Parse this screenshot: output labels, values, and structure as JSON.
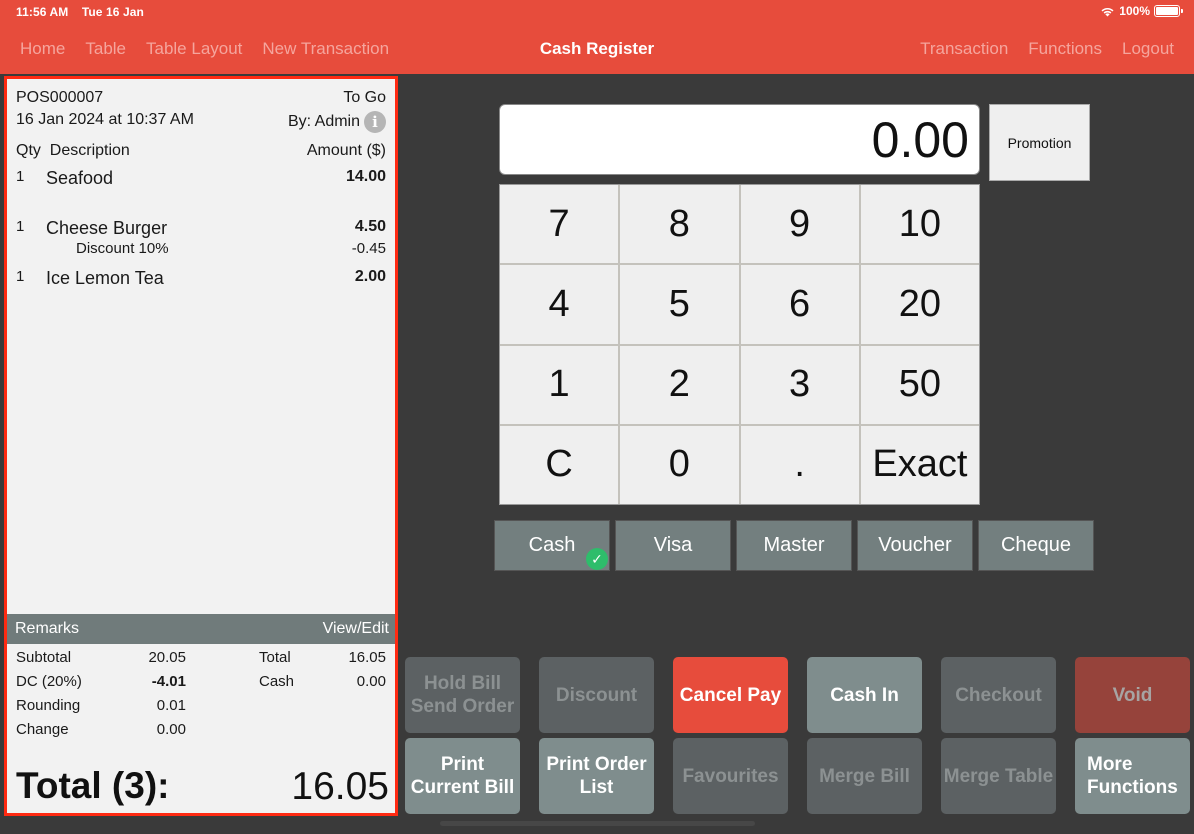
{
  "status_bar": {
    "time": "11:56 AM",
    "date": "Tue 16 Jan",
    "battery": "100%",
    "battery_level": 1.0
  },
  "nav": {
    "left": [
      "Home",
      "Table",
      "Table Layout",
      "New Transaction"
    ],
    "title": "Cash Register",
    "right": [
      "Transaction",
      "Functions",
      "Logout"
    ]
  },
  "receipt": {
    "order_no": "POS000007",
    "order_type": "To Go",
    "datetime": "16 Jan 2024 at 10:37 AM",
    "by": "By: Admin",
    "headers": {
      "qty": "Qty",
      "description": "Description",
      "amount": "Amount ($)"
    },
    "items": [
      {
        "qty": "1",
        "description": "Seafood",
        "amount": "14.00"
      },
      {
        "qty": "1",
        "description": "Cheese Burger",
        "amount": "4.50",
        "sub_description": "Discount 10%",
        "sub_amount": "-0.45"
      },
      {
        "qty": "1",
        "description": "Ice Lemon Tea",
        "amount": "2.00"
      }
    ],
    "remarks_label": "Remarks",
    "remarks_action": "View/Edit",
    "totals_left": [
      {
        "label": "Subtotal",
        "value": "20.05"
      },
      {
        "label": "DC (20%)",
        "value": "-4.01"
      },
      {
        "label": "Rounding",
        "value": "0.01"
      },
      {
        "label": "Change",
        "value": "0.00"
      }
    ],
    "totals_right": [
      {
        "label": "Total",
        "value": "16.05"
      },
      {
        "label": "Cash",
        "value": "0.00"
      }
    ],
    "grand_label": "Total (3):",
    "grand_value": "16.05"
  },
  "display": {
    "value": "0.00"
  },
  "promotion_label": "Promotion",
  "keypad": [
    "7",
    "8",
    "9",
    "10",
    "4",
    "5",
    "6",
    "20",
    "1",
    "2",
    "3",
    "50",
    "C",
    "0",
    ".",
    "Exact"
  ],
  "payment_methods": [
    {
      "label": "Cash",
      "selected": true
    },
    {
      "label": "Visa",
      "selected": false
    },
    {
      "label": "Master",
      "selected": false
    },
    {
      "label": "Voucher",
      "selected": false
    },
    {
      "label": "Cheque",
      "selected": false
    }
  ],
  "functions": [
    {
      "label": "Hold Bill\nSend Order",
      "state": "disabled"
    },
    {
      "label": "Discount",
      "state": "disabled"
    },
    {
      "label": "Cancel Pay",
      "state": "primary"
    },
    {
      "label": "Cash In",
      "state": "enabled"
    },
    {
      "label": "Checkout",
      "state": "disabled"
    },
    {
      "label": "Void",
      "state": "danger-disabled"
    },
    {
      "label": "Print\nCurrent Bill",
      "state": "enabled"
    },
    {
      "label": "Print Order\nList",
      "state": "enabled"
    },
    {
      "label": "Favourites",
      "state": "disabled"
    },
    {
      "label": "Merge Bill",
      "state": "disabled"
    },
    {
      "label": "Merge Table",
      "state": "disabled"
    },
    {
      "label": "More\nFunctions",
      "state": "enabled"
    }
  ],
  "colors": {
    "brand": "#e74c3c",
    "receipt_border": "#ff2a12",
    "selected_check": "#2ebd6b",
    "button_enabled": "#7f8d8d",
    "button_disabled": "#5c6163"
  }
}
